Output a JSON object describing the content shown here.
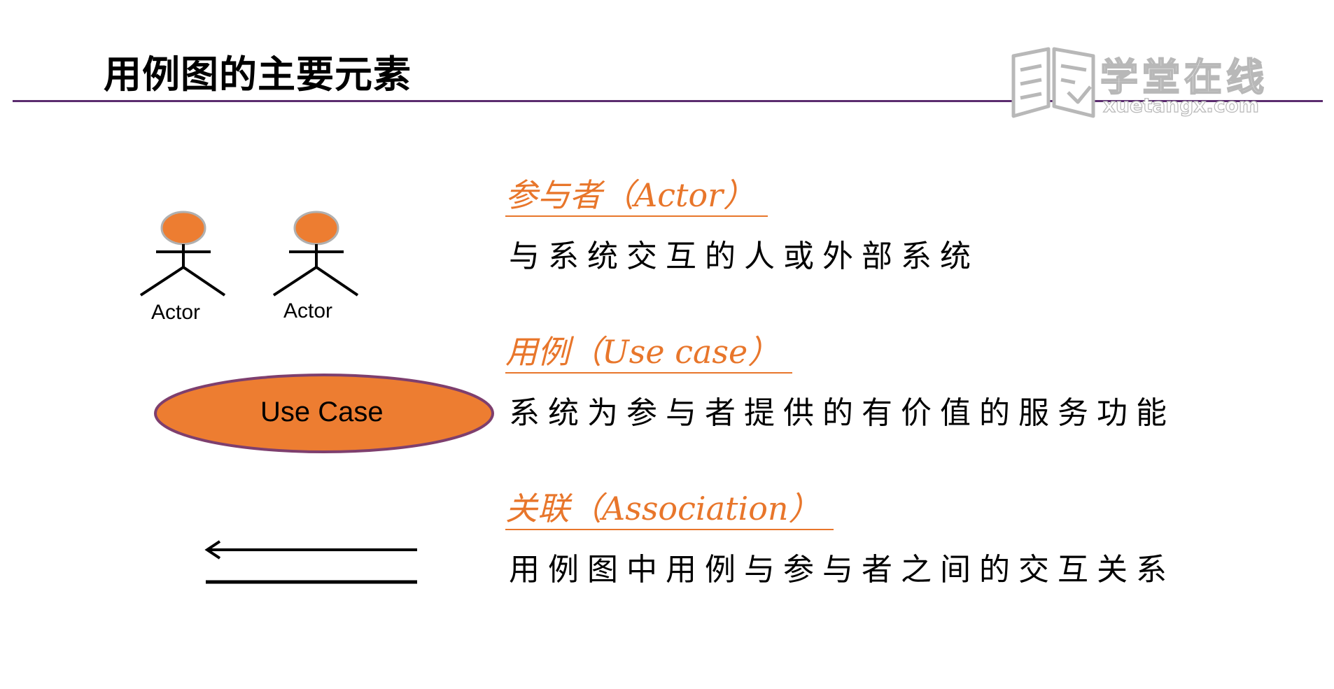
{
  "slide": {
    "title": "用例图的主要元素"
  },
  "logo": {
    "cn": "学堂在线",
    "en": "xuetangx.com"
  },
  "colors": {
    "accent": "#e8762b",
    "rule": "#5b2c6f",
    "ellipse_fill": "#ed7d31",
    "ellipse_stroke": "#7e3f6e"
  },
  "actors": [
    {
      "label": "Actor"
    },
    {
      "label": "Actor"
    }
  ],
  "use_case": {
    "label": "Use Case"
  },
  "elements": [
    {
      "heading": "参与者（Actor）",
      "description": "与系统交互的人或外部系统"
    },
    {
      "heading": "用例（Use case）",
      "description": "系统为参与者提供的有价值的服务功能"
    },
    {
      "heading": "关联（Association）",
      "description": "用例图中用例与参与者之间的交互关系"
    }
  ]
}
